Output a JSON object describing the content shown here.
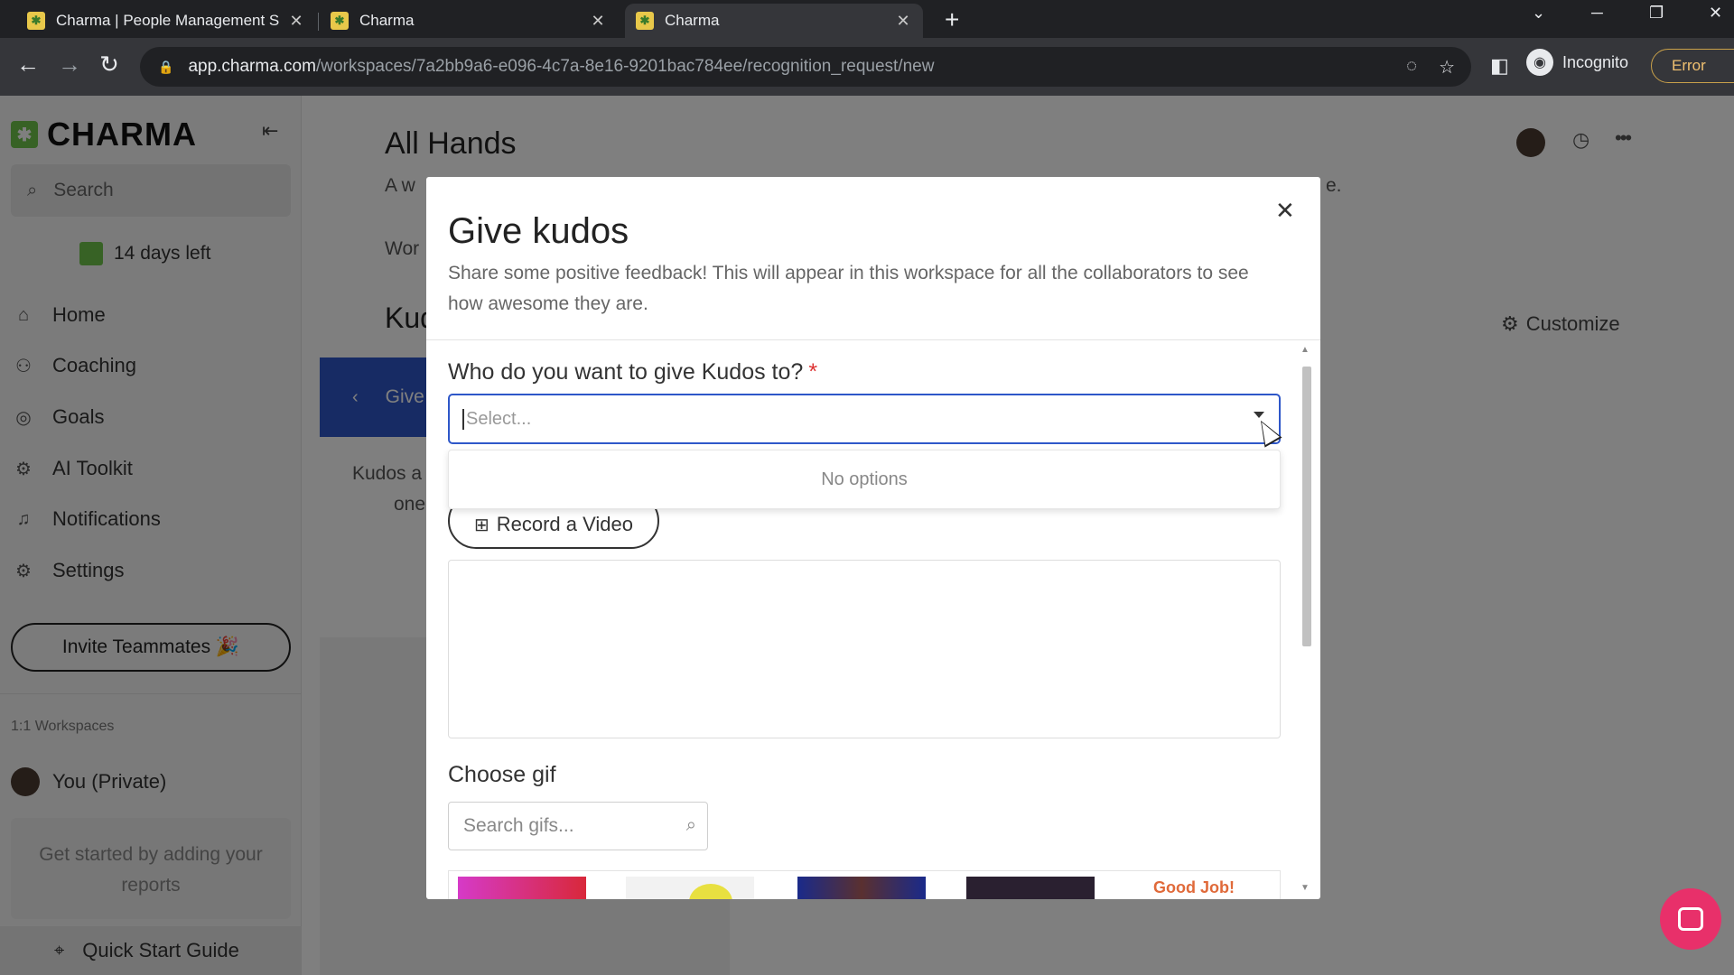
{
  "browser": {
    "tabs": [
      {
        "title": "Charma | People Management S",
        "active": false
      },
      {
        "title": "Charma",
        "active": false
      },
      {
        "title": "Charma",
        "active": true
      }
    ],
    "url_host": "app.charma.com",
    "url_path": "/workspaces/7a2bb9a6-e096-4c7a-8e16-9201bac784ee/recognition_request/new",
    "incognito_label": "Incognito",
    "error_label": "Error"
  },
  "sidebar": {
    "logo": "CHARMA",
    "search_placeholder": "Search",
    "trial_text": "14 days left",
    "nav": [
      {
        "label": "Home",
        "icon": "home-icon"
      },
      {
        "label": "Coaching",
        "icon": "coaching-icon"
      },
      {
        "label": "Goals",
        "icon": "target-icon"
      },
      {
        "label": "AI Toolkit",
        "icon": "robot-icon"
      },
      {
        "label": "Notifications",
        "icon": "bell-icon"
      },
      {
        "label": "Settings",
        "icon": "gear-icon"
      }
    ],
    "invite_label": "Invite Teammates 🎉",
    "workspaces_label": "1:1 Workspaces",
    "workspace_item": "You (Private)",
    "get_started": "Get started by adding your reports",
    "quick_start": "Quick Start Guide"
  },
  "main": {
    "title": "All Hands",
    "subtitle_start": "A w",
    "subtitle_end": "e.",
    "wor_text": "Wor",
    "kudos_heading": "Kud",
    "customize_label": "Customize",
    "give_panel_label": "Give",
    "kudos_desc_line1": "Kudos a",
    "kudos_desc_line2": "one"
  },
  "modal": {
    "title": "Give kudos",
    "description": "Share some positive feedback! This will appear in this workspace for all the collaborators to see how awesome they are.",
    "question": "Who do you want to give Kudos to?",
    "required_mark": "*",
    "select_placeholder": "Select...",
    "no_options": "No options",
    "record_label": "Record a Video",
    "gif_label": "Choose gif",
    "gif_search_placeholder": "Search gifs...",
    "gif_thumb_text": "Good Job!"
  },
  "colors": {
    "accent": "#2e57c9",
    "brand_green": "#6ec44a",
    "chat_button": "#e8306a"
  }
}
